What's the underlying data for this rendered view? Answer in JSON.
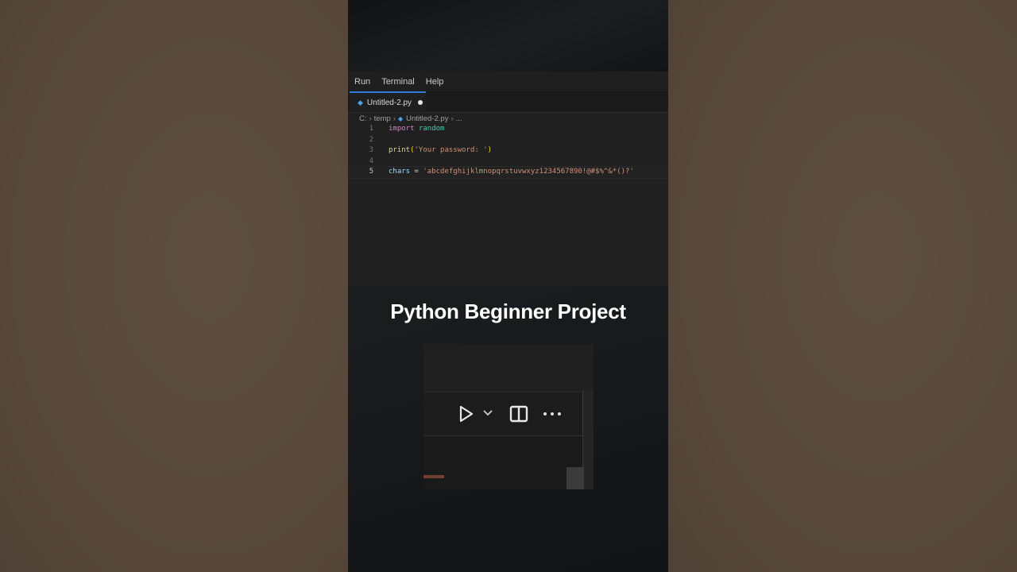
{
  "menu": [
    "Run",
    "Terminal",
    "Help"
  ],
  "tab": {
    "label": "Untitled-2.py"
  },
  "breadcrumb": {
    "drive": "C:",
    "folder": "temp",
    "file": "Untitled-2.py",
    "more": "..."
  },
  "code": {
    "line_numbers": [
      "1",
      "2",
      "3",
      "4",
      "5"
    ],
    "line1": {
      "kw": "import",
      "mod": "random"
    },
    "line3": {
      "fn": "print",
      "open": "(",
      "str": "'Your password: '",
      "close": ")"
    },
    "line5": {
      "var": "chars",
      "op": " = ",
      "str": "'abcdefghijklmnopqrstuvwxyz1234567890!@#$%^&*()?'"
    }
  },
  "headline": "Python Beginner Project",
  "icons": [
    "python-file-icon",
    "run-icon",
    "chevron-down-icon",
    "split-editor-icon",
    "more-icon"
  ],
  "colors": {
    "accent": "#2d7bd6",
    "keyword": "#c586c0",
    "string": "#ce9178"
  }
}
